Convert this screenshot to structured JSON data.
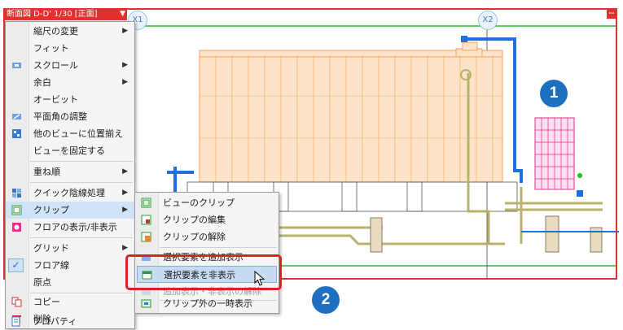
{
  "view": {
    "title": "断面図 D-D' 1/30 [正面]",
    "dropdown_glyph": "▼",
    "pin_glyph": "ꟷ",
    "grid_labels": [
      "X1",
      "X2"
    ]
  },
  "markers": [
    "1",
    "2"
  ],
  "context_menu": {
    "items": [
      {
        "label": "縮尺の変更",
        "submenu": true
      },
      {
        "label": "フィット"
      },
      {
        "label": "スクロール",
        "icon": "scroll-icon",
        "submenu": true
      },
      {
        "label": "余白",
        "submenu": true
      },
      {
        "label": "オービット"
      },
      {
        "label": "平面角の調整",
        "icon": "angle-icon"
      },
      {
        "label": "他のビューに位置揃え",
        "icon": "align-views-icon"
      },
      {
        "label": "ビューを固定する"
      },
      {
        "label": "重ね順",
        "submenu": true
      },
      {
        "label": "クイック陰線処理",
        "icon": "hidden-line-icon",
        "submenu": true
      },
      {
        "label": "クリップ",
        "icon": "clip-icon",
        "submenu": true,
        "active": true
      },
      {
        "label": "フロアの表示/非表示",
        "icon": "floor-toggle-icon"
      },
      {
        "label": "グリッド",
        "submenu": true
      },
      {
        "label": "フロア線",
        "checked": true
      },
      {
        "label": "原点"
      },
      {
        "label": "コピー",
        "icon": "copy-icon"
      },
      {
        "label": "削除",
        "icon": "delete-icon"
      },
      {
        "label": "プロパティ",
        "icon": "properties-icon"
      }
    ]
  },
  "clip_submenu": {
    "items": [
      {
        "label": "ビューのクリップ",
        "icon": "view-clip-icon"
      },
      {
        "label": "クリップの編集",
        "icon": "clip-edit-icon"
      },
      {
        "label": "クリップの解除",
        "icon": "clip-release-icon"
      },
      {
        "label": "選択要素を追加表示",
        "icon": "add-show-icon"
      },
      {
        "label": "選択要素を非表示",
        "icon": "hide-selected-icon",
        "highlighted": true
      },
      {
        "label": "追加表示・非表示の解除",
        "icon": "reset-show-icon",
        "disabled": true
      },
      {
        "label": "クリップ外の一時表示",
        "icon": "temp-show-icon"
      }
    ]
  },
  "colors": {
    "frame": "#e03030",
    "tank": "#f2a25a",
    "pipe_blue": "#1f6fe0",
    "pipe_olive": "#b9b36a",
    "grate": "#e0308a",
    "marker": "#1e6fc0",
    "floor_line": "#22c022"
  }
}
